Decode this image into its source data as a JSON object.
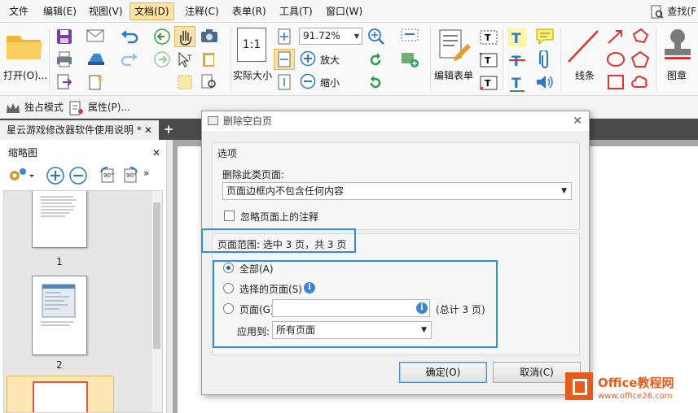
{
  "menu": {
    "items": [
      "文件",
      "编辑(E)",
      "视图(V)",
      "文档(D)",
      "注释(C)",
      "表单(R)",
      "工具(T)",
      "窗口(W)"
    ],
    "active": "文档(D)",
    "search_label": "查找(F"
  },
  "ribbon": {
    "open_label": "打开(O)...",
    "zoom_value": "91.72%",
    "zoom_in_label": "放大",
    "zoom_out_label": "缩小",
    "actual_size_label": "实际大小",
    "actual_size_icon_text": "1:1",
    "edit_form_label": "编辑表单",
    "lines_label": "线条",
    "stamp_label": "图章"
  },
  "toolbar2": {
    "exclusive_mode_label": "独占模式",
    "properties_label": "属性(P)..."
  },
  "tabs": {
    "doc_tab_label": "星云游戏修改器软件使用说明 *",
    "new_tab_label": "+"
  },
  "thumbnails": {
    "title": "缩略图",
    "rotate_label": "90°",
    "pages": [
      "1",
      "2"
    ]
  },
  "dialog": {
    "title": "删除空白页",
    "options_header": "选项",
    "delete_type_label": "删除此类页面:",
    "delete_type_value": "页面边框内不包含任何内容",
    "ignore_annotations_label": "忽略页面上的注释",
    "page_range_text": "页面范围: 选中 3 页，共 3 页",
    "radio_all_label": "全部(A)",
    "radio_selected_label": "选择的页面(S)",
    "radio_pages_label": "页面(G)",
    "pages_input_value": "",
    "total_pages_label": "(总计 3 页)",
    "apply_to_label": "应用到:",
    "apply_to_value": "所有页面",
    "ok_label": "确定(O)",
    "cancel_label": "取消(C)",
    "close_symbol": "✕",
    "info_symbol": "i"
  },
  "watermark": {
    "line1": "Office教程网",
    "line2": "www.office26.com"
  },
  "colors": {
    "highlight": "#2d8fd8",
    "menu_active": "#fbe3a8",
    "watermark": "#e55b1b"
  }
}
